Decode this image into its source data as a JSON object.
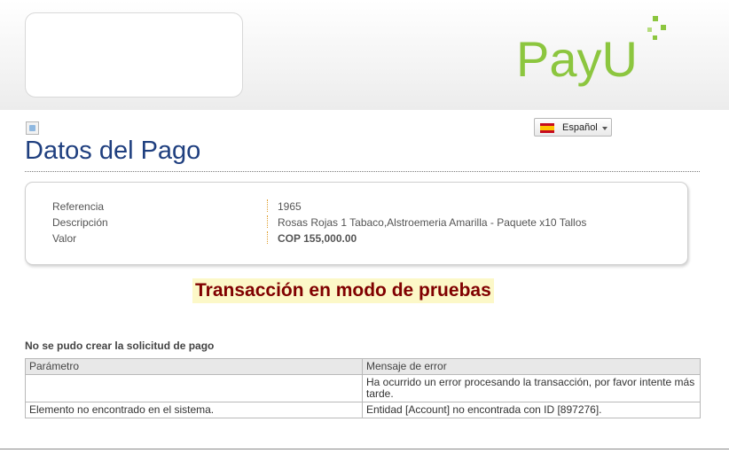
{
  "header": {
    "logo_text": "PayU",
    "logo_color": "#8cc63f"
  },
  "language": {
    "selected": "Español",
    "flag_icon": "spain-flag-icon"
  },
  "page": {
    "title": "Datos del Pago"
  },
  "details": {
    "rows": [
      {
        "label": "Referencia",
        "value": "1965"
      },
      {
        "label": "Descripción",
        "value": "Rosas Rojas 1 Tabaco,Alstroemeria Amarilla - Paquete x10 Tallos"
      },
      {
        "label": "Valor",
        "value": "COP 155,000.00"
      }
    ]
  },
  "banner": {
    "text": "Transacción en modo de pruebas",
    "color": "#800000",
    "background": "#fcf8c8"
  },
  "errors": {
    "heading": "No se pudo crear la solicitud de pago",
    "columns": [
      "Parámetro",
      "Mensaje de error"
    ],
    "rows": [
      {
        "param": "",
        "message": "Ha ocurrido un error procesando la transacción, por favor intente más tarde."
      },
      {
        "param": "Elemento no encontrado en el sistema.",
        "message": "Entidad [Account] no encontrada con ID [897276]."
      }
    ]
  }
}
